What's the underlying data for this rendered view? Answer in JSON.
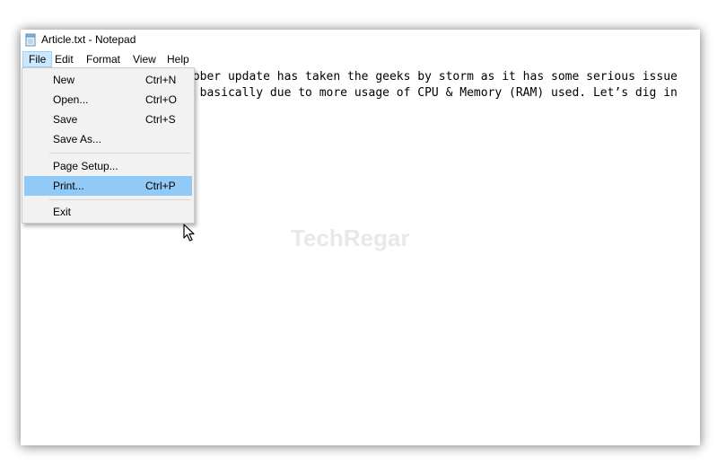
{
  "window": {
    "title": "Article.txt - Notepad",
    "icon": "notepad-icon"
  },
  "menubar": {
    "items": [
      "File",
      "Edit",
      "Format",
      "View",
      "Help"
    ],
    "active": "File"
  },
  "editor": {
    "lines": [
      "tober update has taken the geeks by storm as it has some serious issue",
      "s basically due to more usage of CPU & Memory (RAM) used. Let’s dig in"
    ],
    "watermark": "TechRegar"
  },
  "file_menu": {
    "items": [
      {
        "label": "New",
        "shortcut": "Ctrl+N"
      },
      {
        "label": "Open...",
        "shortcut": "Ctrl+O"
      },
      {
        "label": "Save",
        "shortcut": "Ctrl+S"
      },
      {
        "label": "Save As...",
        "shortcut": ""
      },
      {
        "label": "Page Setup...",
        "shortcut": ""
      },
      {
        "label": "Print...",
        "shortcut": "Ctrl+P"
      },
      {
        "label": "Exit",
        "shortcut": ""
      }
    ],
    "highlighted": "Print..."
  },
  "colors": {
    "menu_active_bg": "#cce8ff",
    "menu_hover_bg": "#91c9f7",
    "dropdown_bg": "#f2f2f2"
  }
}
